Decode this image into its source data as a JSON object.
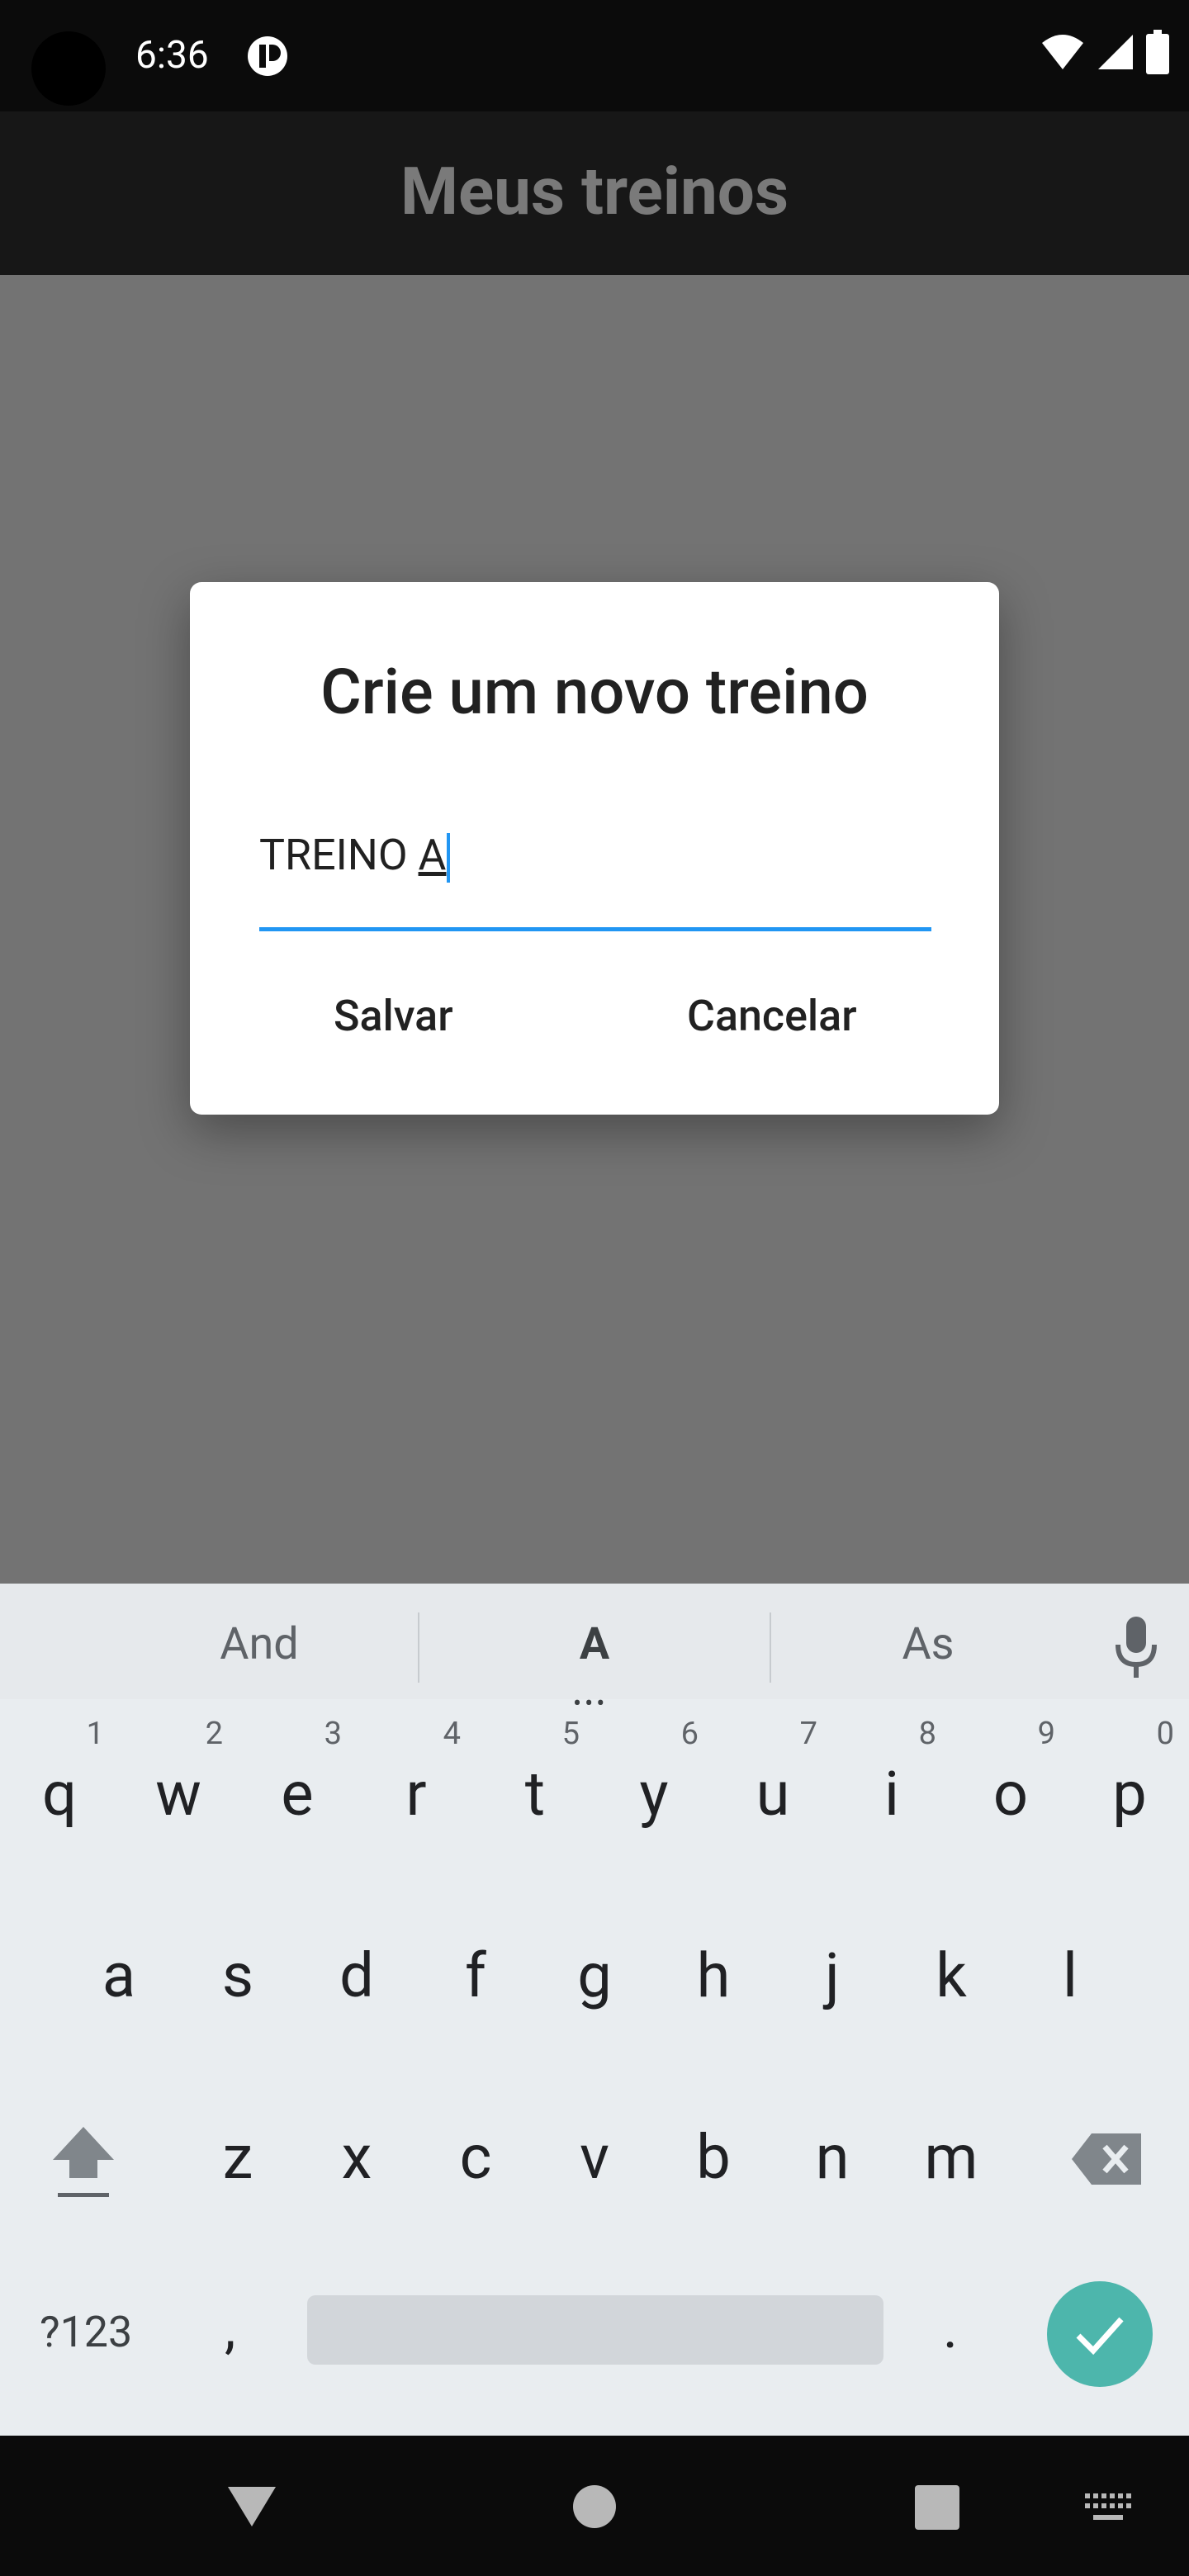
{
  "status_bar": {
    "time": "6:36"
  },
  "app_bar": {
    "title": "Meus treinos"
  },
  "dialog": {
    "title": "Crie um novo treino",
    "input_value_prefix": "TREINO ",
    "input_value_last": "A",
    "save_label": "Salvar",
    "cancel_label": "Cancelar"
  },
  "keyboard": {
    "suggestions": [
      "And",
      "A",
      "As"
    ],
    "row1": [
      {
        "key": "q",
        "hint": "1"
      },
      {
        "key": "w",
        "hint": "2"
      },
      {
        "key": "e",
        "hint": "3"
      },
      {
        "key": "r",
        "hint": "4"
      },
      {
        "key": "t",
        "hint": "5"
      },
      {
        "key": "y",
        "hint": "6"
      },
      {
        "key": "u",
        "hint": "7"
      },
      {
        "key": "i",
        "hint": "8"
      },
      {
        "key": "o",
        "hint": "9"
      },
      {
        "key": "p",
        "hint": "0"
      }
    ],
    "row2": [
      "a",
      "s",
      "d",
      "f",
      "g",
      "h",
      "j",
      "k",
      "l"
    ],
    "row3": [
      "z",
      "x",
      "c",
      "v",
      "b",
      "n",
      "m"
    ],
    "symbols_label": "?123",
    "comma": ",",
    "period": "."
  },
  "colors": {
    "accent": "#2196f3",
    "enter_key": "#4db6ac",
    "fab": "#2f2f2f"
  }
}
